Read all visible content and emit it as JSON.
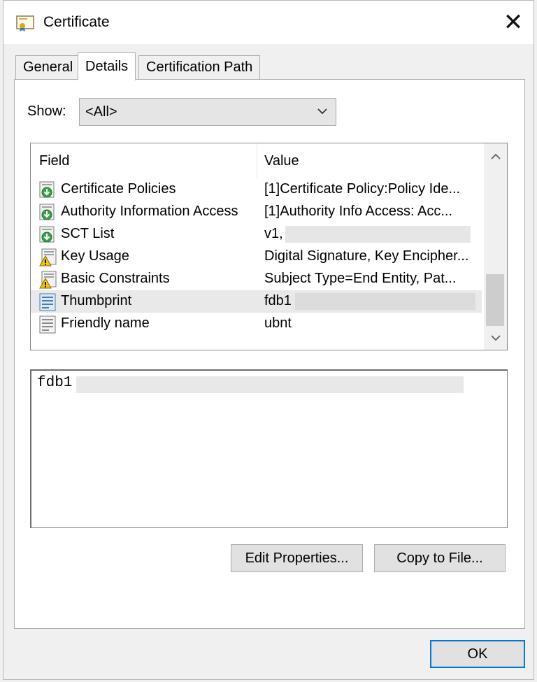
{
  "window": {
    "title": "Certificate",
    "close_glyph": "✕"
  },
  "tabs": [
    {
      "label": "General",
      "active": false
    },
    {
      "label": "Details",
      "active": true
    },
    {
      "label": "Certification Path",
      "active": false
    }
  ],
  "show": {
    "label": "Show:",
    "value": "<All>"
  },
  "list": {
    "columns": {
      "field": "Field",
      "value": "Value"
    },
    "rows": [
      {
        "field": "Certificate Policies",
        "value": "[1]Certificate Policy:Policy Ide...",
        "icon": "extension-icon"
      },
      {
        "field": "Authority Information Access",
        "value": "[1]Authority Info Access: Acc...",
        "icon": "extension-icon"
      },
      {
        "field": "SCT List",
        "value": "v1,",
        "icon": "extension-icon"
      },
      {
        "field": "Key Usage",
        "value": "Digital Signature, Key Encipher...",
        "icon": "critical-extension-icon"
      },
      {
        "field": "Basic Constraints",
        "value": "Subject Type=End Entity, Pat...",
        "icon": "critical-extension-icon"
      },
      {
        "field": "Thumbprint",
        "value": "fdb1",
        "icon": "property-icon",
        "selected": true
      },
      {
        "field": "Friendly name",
        "value": "ubnt",
        "icon": "property-icon"
      }
    ]
  },
  "detail": {
    "text": "fdb1"
  },
  "buttons": {
    "edit_properties": "Edit Properties...",
    "copy_to_file": "Copy to File...",
    "ok": "OK"
  },
  "colors": {
    "accent": "#0078d7",
    "selected_row": "#e9e9e9",
    "scroll_thumb": "#cdcdcd"
  }
}
